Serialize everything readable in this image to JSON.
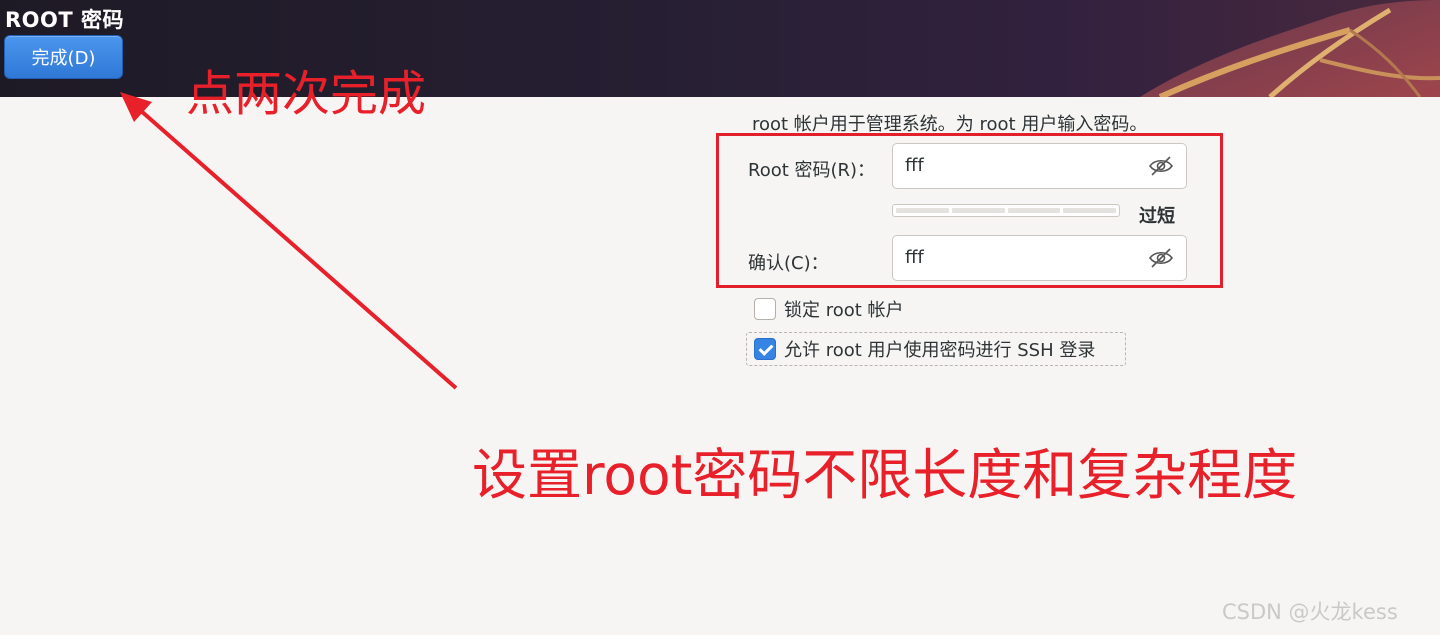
{
  "window": {
    "title": "ROOT 密码"
  },
  "toolbar": {
    "done_label": "完成(D)",
    "accent_color": "#3584e4"
  },
  "form": {
    "description": "root 帐户用于管理系统。为 root 用户输入密码。",
    "password_label": "Root 密码(R)：",
    "password_value": "fff",
    "strength_label": "过短",
    "strength_level": 0,
    "confirm_label": "确认(C)：",
    "confirm_value": "fff",
    "lock_root_label": "锁定 root 帐户",
    "lock_root_checked": false,
    "allow_ssh_label": "允许 root 用户使用密码进行 SSH 登录",
    "allow_ssh_checked": true
  },
  "annotations": {
    "click_twice": "点两次完成",
    "note": "设置root密码不限长度和复杂程度",
    "color": "#e8202a"
  },
  "watermark": "CSDN @火龙kess",
  "icons": [
    "eye-hidden-icon",
    "checkbox-icon",
    "arrow-annotation"
  ]
}
